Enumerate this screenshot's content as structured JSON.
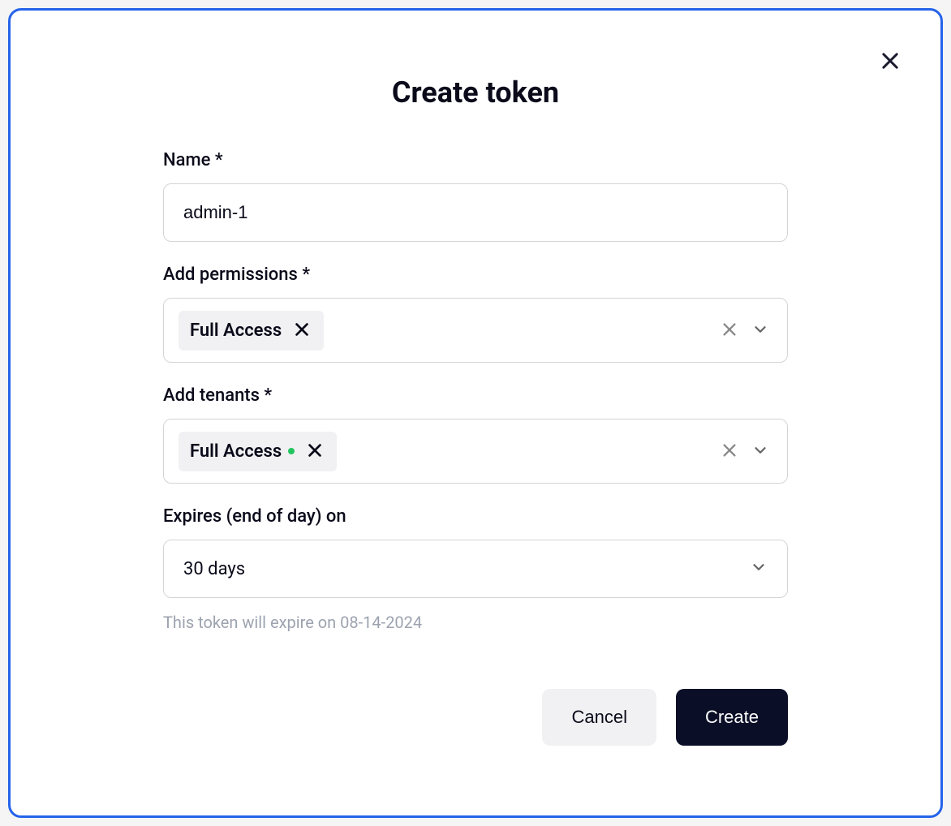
{
  "modal": {
    "title": "Create token",
    "fields": {
      "name": {
        "label": "Name *",
        "value": "admin-1"
      },
      "permissions": {
        "label": "Add permissions *",
        "chips": [
          {
            "label": "Full Access"
          }
        ]
      },
      "tenants": {
        "label": "Add tenants *",
        "chips": [
          {
            "label": "Full Access",
            "status": "green"
          }
        ]
      },
      "expires": {
        "label": "Expires (end of day) on",
        "value": "30 days",
        "helper": "This token will expire on 08-14-2024"
      }
    },
    "buttons": {
      "cancel": "Cancel",
      "create": "Create"
    }
  }
}
